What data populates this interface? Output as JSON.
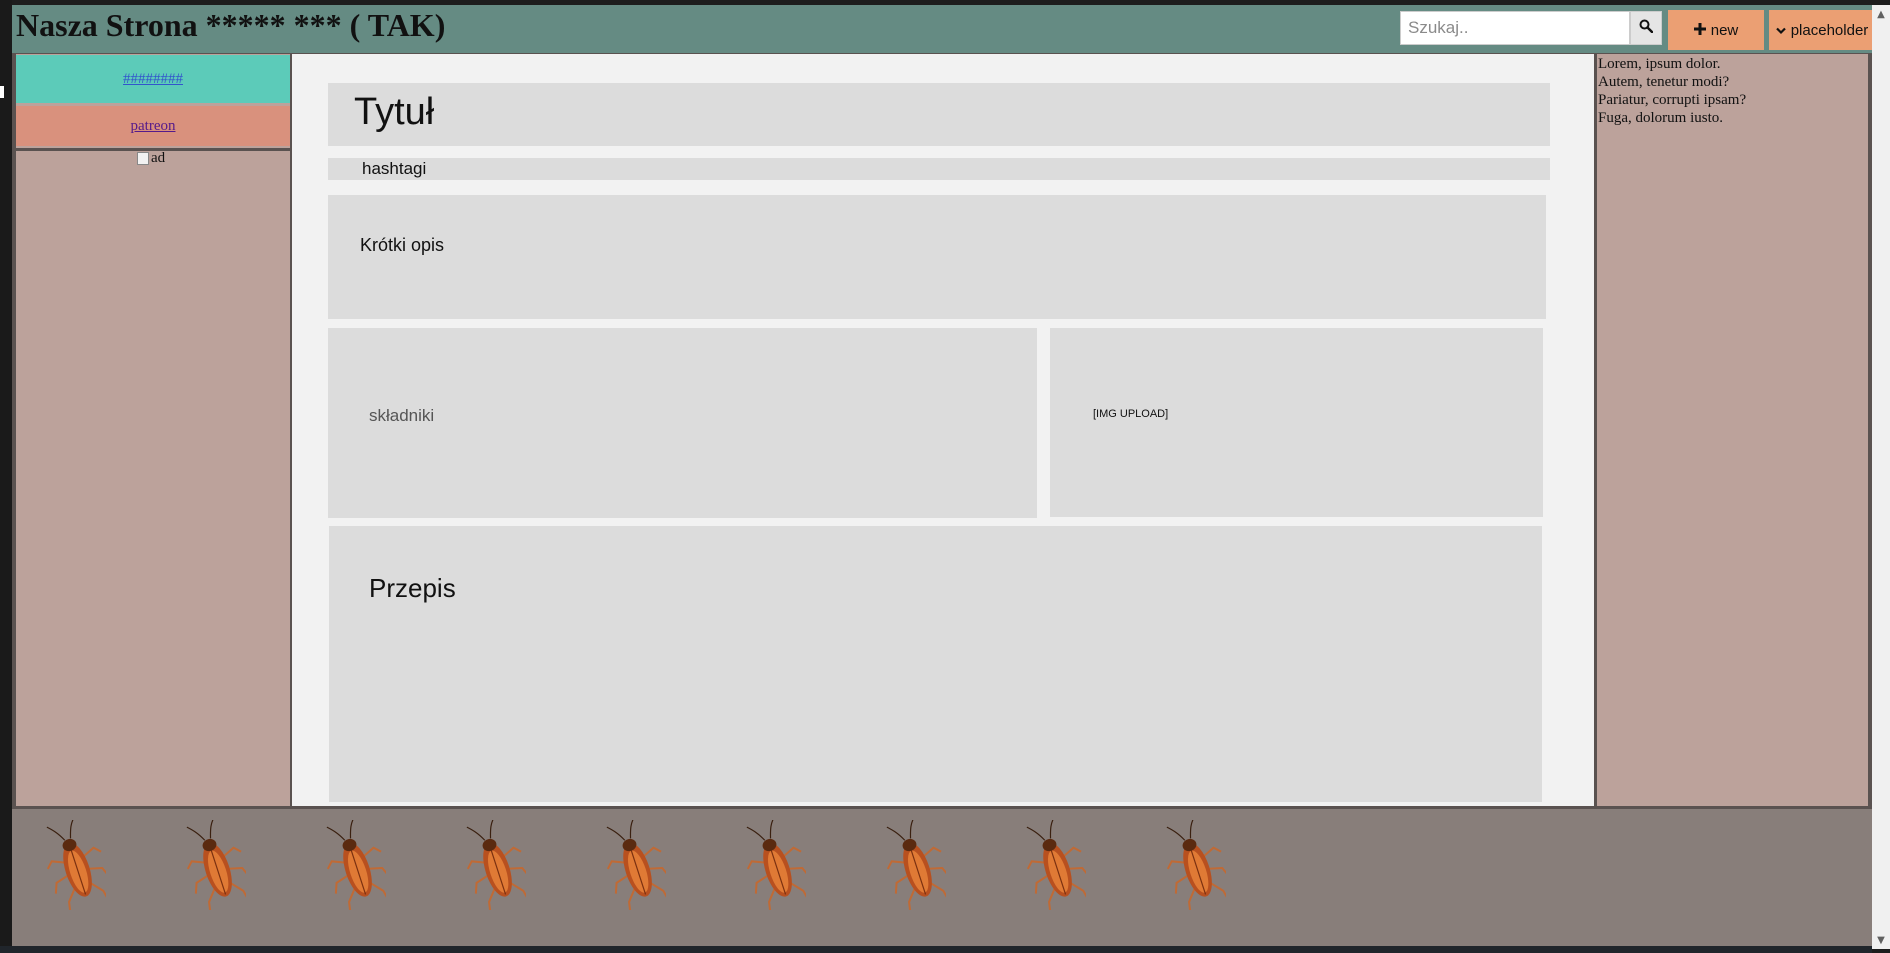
{
  "header": {
    "site_title": "Nasza Strona ***** *** ( TAK)",
    "search_placeholder": "Szukaj..",
    "search_icon": "search-icon",
    "new_button_label": "new",
    "new_button_icon": "plus-icon",
    "placeholder_button_label": "placeholder",
    "placeholder_button_icon": "chevron-down-icon"
  },
  "sidebar_left": {
    "link_hash": "########",
    "link_patreon": "patreon",
    "ad_alt": "ad"
  },
  "main": {
    "title": "Tytuł",
    "hashtags": "hashtagi",
    "short_description": "Krótki opis",
    "ingredients": "składniki",
    "image_upload": "[IMG UPLOAD]",
    "recipe": "Przepis"
  },
  "sidebar_right": {
    "lines": [
      "Lorem, ipsum dolor.",
      "Autem, tenetur modi?",
      "Pariatur, corrupti ipsam?",
      "Fuga, dolorum iusto."
    ]
  },
  "footer": {
    "decoration": "cockroach-image",
    "count": 9
  },
  "colors": {
    "header_bg": "#658b83",
    "accent_button": "#eb9f73",
    "sidebar_bg": "#bca29b",
    "link_hash_bg": "#5ccbb9",
    "link_patreon_bg": "#d9917d",
    "content_box": "#dcdcdc",
    "footer_bg": "#887e7a"
  }
}
